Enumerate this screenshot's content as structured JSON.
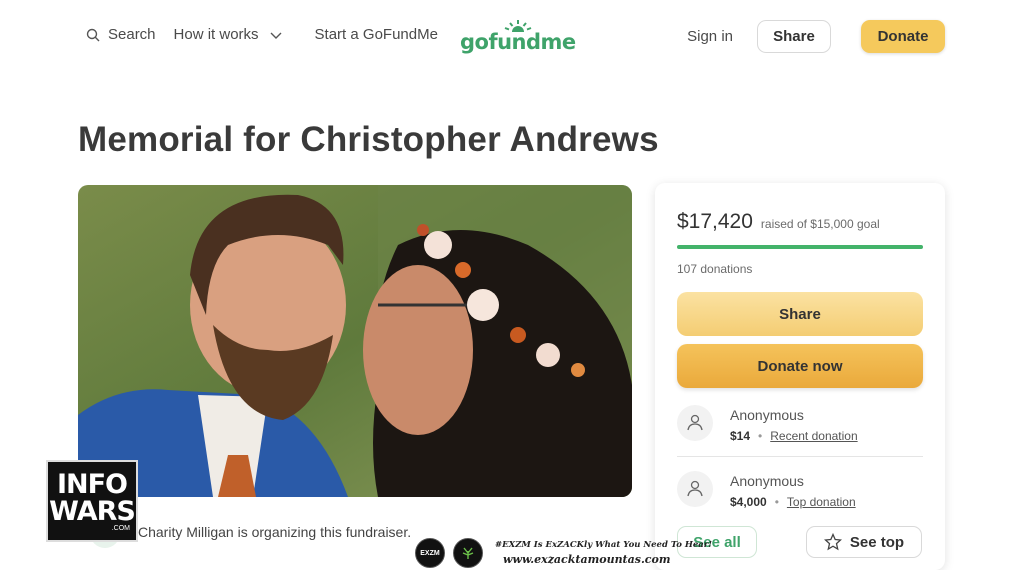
{
  "header": {
    "search_label": "Search",
    "how_it_works_label": "How it works",
    "start_label": "Start a GoFundMe",
    "logo_text": "gofundme",
    "signin_label": "Sign in",
    "share_label": "Share",
    "donate_label": "Donate"
  },
  "campaign": {
    "title": "Memorial for Christopher Andrews",
    "organizer_text": "Charity Milligan is organizing this fundraiser.",
    "raised_amount": "$17,420",
    "raised_goal_text": "raised of $15,000 goal",
    "progress_fraction": 1.0,
    "donations_count": "107 donations",
    "share_button": "Share",
    "donate_button": "Donate now",
    "donors": [
      {
        "name": "Anonymous",
        "amount": "$14",
        "tag": "Recent donation"
      },
      {
        "name": "Anonymous",
        "amount": "$4,000",
        "tag": "Top donation"
      }
    ],
    "see_all_label": "See all",
    "see_top_label": "See top"
  },
  "overlays": {
    "infowars_line1": "INFO",
    "infowars_line2": "WARS",
    "infowars_com": ".COM",
    "exzm_badge": "EXZM",
    "exzm_line1": "#EXZM Is ExZACKly What You Need To Hear!",
    "exzm_line2": "www.exzacktamountas.com"
  },
  "colors": {
    "brand_green": "#3fa36a",
    "donate_yellow": "#f5c95c",
    "progress_green": "#43b36a"
  },
  "icons": [
    "search-icon",
    "chevron-down-icon",
    "user-heart-icon",
    "star-icon"
  ]
}
